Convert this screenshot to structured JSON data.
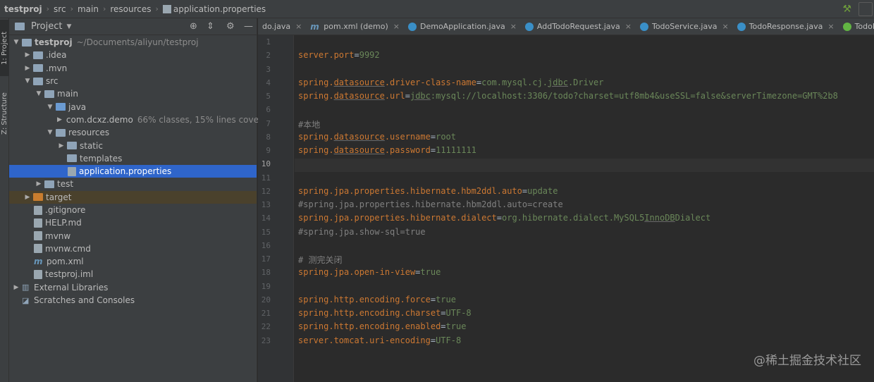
{
  "breadcrumb": [
    "testproj",
    "src",
    "main",
    "resources",
    "application.properties"
  ],
  "toolstrip": {
    "project_tab": "1: Project",
    "structure_tab": "Z: Structure"
  },
  "panel": {
    "title": "Project"
  },
  "tree": [
    {
      "indent": 0,
      "arrow": "▼",
      "icon": "folder",
      "label": "testproj",
      "extra": "~/Documents/aliyun/testproj",
      "bold": true
    },
    {
      "indent": 1,
      "arrow": "▶",
      "icon": "folder",
      "label": ".idea"
    },
    {
      "indent": 1,
      "arrow": "▶",
      "icon": "folder",
      "label": ".mvn"
    },
    {
      "indent": 1,
      "arrow": "▼",
      "icon": "folder",
      "label": "src"
    },
    {
      "indent": 2,
      "arrow": "▼",
      "icon": "folder",
      "label": "main"
    },
    {
      "indent": 3,
      "arrow": "▼",
      "icon": "folder-blue",
      "label": "java"
    },
    {
      "indent": 4,
      "arrow": "▶",
      "icon": "folder-pkg",
      "label": "com.dcxz.demo",
      "extra": "66% classes, 15% lines cove"
    },
    {
      "indent": 3,
      "arrow": "▼",
      "icon": "folder",
      "label": "resources"
    },
    {
      "indent": 4,
      "arrow": "▶",
      "icon": "folder",
      "label": "static"
    },
    {
      "indent": 4,
      "arrow": "",
      "icon": "folder",
      "label": "templates"
    },
    {
      "indent": 4,
      "arrow": "",
      "icon": "file",
      "label": "application.properties",
      "selected": true
    },
    {
      "indent": 2,
      "arrow": "▶",
      "icon": "folder",
      "label": "test"
    },
    {
      "indent": 1,
      "arrow": "▶",
      "icon": "folder-orange",
      "label": "target",
      "target": true
    },
    {
      "indent": 1,
      "arrow": "",
      "icon": "file",
      "label": ".gitignore"
    },
    {
      "indent": 1,
      "arrow": "",
      "icon": "file",
      "label": "HELP.md"
    },
    {
      "indent": 1,
      "arrow": "",
      "icon": "file",
      "label": "mvnw"
    },
    {
      "indent": 1,
      "arrow": "",
      "icon": "file",
      "label": "mvnw.cmd"
    },
    {
      "indent": 1,
      "arrow": "",
      "icon": "m",
      "label": "pom.xml"
    },
    {
      "indent": 1,
      "arrow": "",
      "icon": "file",
      "label": "testproj.iml"
    },
    {
      "indent": 0,
      "arrow": "▶",
      "icon": "lib",
      "label": "External Libraries"
    },
    {
      "indent": 0,
      "arrow": "",
      "icon": "lib",
      "label": "Scratches and Consoles"
    }
  ],
  "tabs": [
    {
      "label": "do.java",
      "icon": "none"
    },
    {
      "label": "pom.xml (demo)",
      "icon": "m"
    },
    {
      "label": "DemoApplication.java",
      "icon": "c"
    },
    {
      "label": "AddTodoRequest.java",
      "icon": "c"
    },
    {
      "label": "TodoService.java",
      "icon": "c"
    },
    {
      "label": "TodoResponse.java",
      "icon": "c"
    },
    {
      "label": "TodoRepository.java",
      "icon": "i"
    }
  ],
  "editor": {
    "line_numbers": [
      "1",
      "2",
      "3",
      "4",
      "5",
      "6",
      "7",
      "8",
      "9",
      "10",
      "11",
      "12",
      "13",
      "14",
      "15",
      "16",
      "17",
      "18",
      "19",
      "20",
      "21",
      "22",
      "23"
    ],
    "current_line": "10",
    "lines": [
      {
        "n": 2,
        "parts": [
          [
            "k",
            "server.port"
          ],
          [
            "n",
            "="
          ],
          [
            "v",
            "9992"
          ]
        ]
      },
      {
        "n": 4,
        "parts": [
          [
            "k",
            "spring."
          ],
          [
            "ku",
            "datasource"
          ],
          [
            "k",
            ".driver-class-name"
          ],
          [
            "n",
            "="
          ],
          [
            "v",
            "com.mysql.cj."
          ],
          [
            "vu",
            "jdbc"
          ],
          [
            "v",
            ".Driver"
          ]
        ]
      },
      {
        "n": 5,
        "parts": [
          [
            "k",
            "spring."
          ],
          [
            "ku",
            "datasource"
          ],
          [
            "k",
            ".url"
          ],
          [
            "n",
            "="
          ],
          [
            "vu",
            "jdbc"
          ],
          [
            "v",
            ":mysql://localhost:3306/todo?charset=utf8mb4&useSSL=false&serverTimezone=GMT%2b8"
          ]
        ]
      },
      {
        "n": 7,
        "parts": [
          [
            "c",
            "#本地"
          ]
        ]
      },
      {
        "n": 8,
        "parts": [
          [
            "k",
            "spring."
          ],
          [
            "ku",
            "datasource"
          ],
          [
            "k",
            ".username"
          ],
          [
            "n",
            "="
          ],
          [
            "v",
            "root"
          ]
        ]
      },
      {
        "n": 9,
        "parts": [
          [
            "k",
            "spring."
          ],
          [
            "ku",
            "datasource"
          ],
          [
            "k",
            ".password"
          ],
          [
            "n",
            "="
          ],
          [
            "v",
            "11111111"
          ]
        ]
      },
      {
        "n": 12,
        "parts": [
          [
            "k",
            "spring.jpa.properties.hibernate.hbm2ddl.auto"
          ],
          [
            "n",
            "="
          ],
          [
            "v",
            "update"
          ]
        ]
      },
      {
        "n": 13,
        "parts": [
          [
            "c",
            "#spring.jpa.properties.hibernate.hbm2ddl.auto=create"
          ]
        ]
      },
      {
        "n": 14,
        "parts": [
          [
            "k",
            "spring.jpa.properties.hibernate.dialect"
          ],
          [
            "n",
            "="
          ],
          [
            "v",
            "org.hibernate.dialect.MySQL5"
          ],
          [
            "vu",
            "InnoDB"
          ],
          [
            "v",
            "Dialect"
          ]
        ]
      },
      {
        "n": 15,
        "parts": [
          [
            "c",
            "#spring.jpa.show-sql=true"
          ]
        ]
      },
      {
        "n": 17,
        "parts": [
          [
            "c",
            "# 测完关闭"
          ]
        ]
      },
      {
        "n": 18,
        "parts": [
          [
            "k",
            "spring.jpa.open-in-view"
          ],
          [
            "n",
            "="
          ],
          [
            "v",
            "true"
          ]
        ]
      },
      {
        "n": 20,
        "parts": [
          [
            "k",
            "spring.http.encoding.force"
          ],
          [
            "n",
            "="
          ],
          [
            "v",
            "true"
          ]
        ]
      },
      {
        "n": 21,
        "parts": [
          [
            "k",
            "spring.http.encoding.charset"
          ],
          [
            "n",
            "="
          ],
          [
            "v",
            "UTF-8"
          ]
        ]
      },
      {
        "n": 22,
        "parts": [
          [
            "k",
            "spring.http.encoding.enabled"
          ],
          [
            "n",
            "="
          ],
          [
            "v",
            "true"
          ]
        ]
      },
      {
        "n": 23,
        "parts": [
          [
            "k",
            "server.tomcat.uri-encoding"
          ],
          [
            "n",
            "="
          ],
          [
            "v",
            "UTF-8"
          ]
        ]
      }
    ]
  },
  "watermark": "@稀土掘金技术社区",
  "colors": {
    "keyword": "#cc7832",
    "value": "#6a8759",
    "comment": "#808080",
    "selection": "#2f65ca",
    "background": "#2b2b2b"
  }
}
